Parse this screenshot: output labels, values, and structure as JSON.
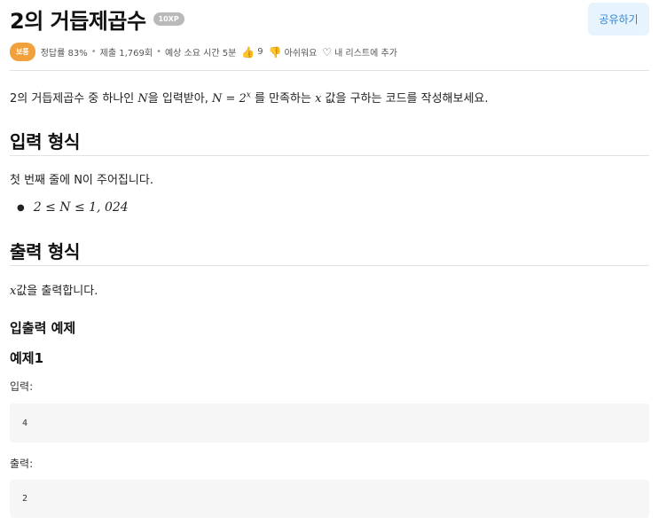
{
  "header": {
    "title": "2의 거듭제곱수",
    "xp_badge": "10XP",
    "share_label": "공유하기"
  },
  "meta": {
    "difficulty": "보통",
    "accuracy": "정답률 83%",
    "submissions": "제출 1,769회",
    "time": "예상 소요 시간 5분",
    "like_count": "9",
    "dislike_label": "아쉬워요",
    "list_label": "내 리스트에 추가"
  },
  "problem": {
    "desc_pre": "2의 거듭제곱수 중 하나인 ",
    "desc_var": "N",
    "desc_mid": "을 입력받아, ",
    "desc_eq": "N = 2",
    "desc_exp": "x",
    "desc_mid2": " 를 만족하는 ",
    "desc_x": "x",
    "desc_post": " 값을 구하는 코드를 작성해보세요."
  },
  "input_section": {
    "heading": "입력 형식",
    "text": "첫 번째 줄에 N이 주어집니다.",
    "constraint": "2 ≤ N ≤ 1, 024"
  },
  "output_section": {
    "heading": "출력 형식",
    "var": "x",
    "text": "값을 출력합니다."
  },
  "examples": {
    "heading": "입출력 예제",
    "example_title": "예제1",
    "input_label": "입력:",
    "input_value": "4",
    "output_label": "출력:",
    "output_value": "2"
  }
}
